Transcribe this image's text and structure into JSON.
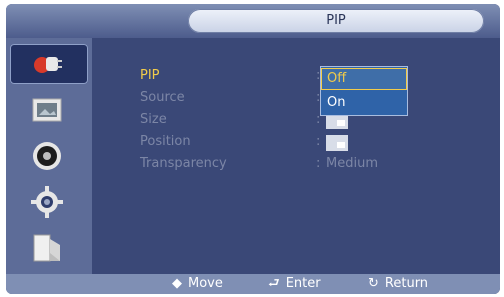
{
  "header": {
    "title": "PIP"
  },
  "sidebar": {
    "items": [
      {
        "icon": "input-plug-icon",
        "active": true
      },
      {
        "icon": "picture-icon",
        "active": false
      },
      {
        "icon": "sound-icon",
        "active": false
      },
      {
        "icon": "setup-gear-icon",
        "active": false
      },
      {
        "icon": "multi-screen-icon",
        "active": false
      }
    ]
  },
  "menu": {
    "rows": [
      {
        "label": "PIP",
        "value": ""
      },
      {
        "label": "Source",
        "value": ""
      },
      {
        "label": "Size",
        "value": ""
      },
      {
        "label": "Position",
        "value": ""
      },
      {
        "label": "Transparency",
        "value": "Medium"
      }
    ],
    "separator": ":"
  },
  "dropdown": {
    "options": [
      "Off",
      "On"
    ],
    "selected": "Off"
  },
  "footer": {
    "move": "Move",
    "enter": "Enter",
    "return": "Return",
    "move_symbol": "◆",
    "enter_symbol": "⮐",
    "return_symbol": "↻"
  }
}
